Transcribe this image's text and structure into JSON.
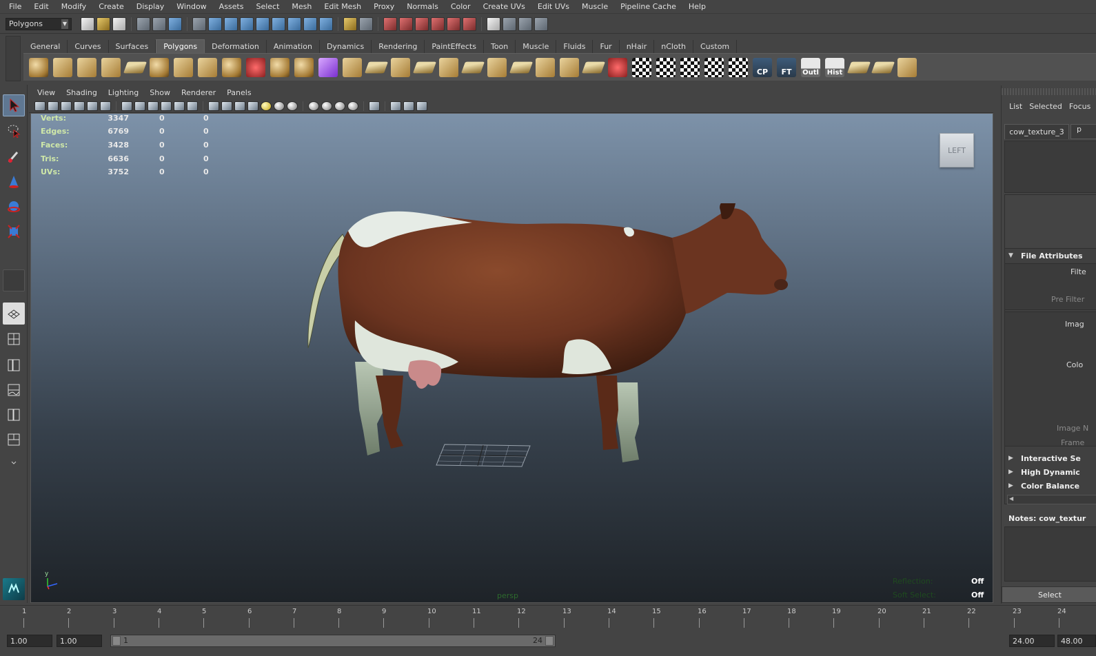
{
  "menubar": [
    "File",
    "Edit",
    "Modify",
    "Create",
    "Display",
    "Window",
    "Assets",
    "Select",
    "Mesh",
    "Edit Mesh",
    "Proxy",
    "Normals",
    "Color",
    "Create UVs",
    "Edit UVs",
    "Muscle",
    "Pipeline Cache",
    "Help"
  ],
  "status_line": {
    "mode": "Polygons"
  },
  "shelf_tabs": [
    "General",
    "Curves",
    "Surfaces",
    "Polygons",
    "Deformation",
    "Animation",
    "Dynamics",
    "Rendering",
    "PaintEffects",
    "Toon",
    "Muscle",
    "Fluids",
    "Fur",
    "nHair",
    "nCloth",
    "Custom"
  ],
  "shelf_active_tab": "Polygons",
  "shelf_text_icons": {
    "cp": "CP",
    "ft": "FT",
    "outl": "Outl",
    "hist": "Hist"
  },
  "viewport_menu": [
    "View",
    "Shading",
    "Lighting",
    "Show",
    "Renderer",
    "Panels"
  ],
  "hud": {
    "rows": [
      {
        "label": "Verts:",
        "v1": "3347",
        "v2": "0",
        "v3": "0"
      },
      {
        "label": "Edges:",
        "v1": "6769",
        "v2": "0",
        "v3": "0"
      },
      {
        "label": "Faces:",
        "v1": "3428",
        "v2": "0",
        "v3": "0"
      },
      {
        "label": "Tris:",
        "v1": "6636",
        "v2": "0",
        "v3": "0"
      },
      {
        "label": "UVs:",
        "v1": "3752",
        "v2": "0",
        "v3": "0"
      }
    ],
    "camera": "persp",
    "view_cube": "LEFT",
    "axis_y": "y",
    "reflection_label": "Reflection:",
    "reflection_value": "Off",
    "soft_select_label": "Soft Select:",
    "soft_select_value": "Off"
  },
  "attribute_editor": {
    "top_tabs": [
      "List",
      "Selected",
      "Focus"
    ],
    "node_tab": "cow_texture_3",
    "node_tab2": "p",
    "sections": [
      {
        "label": "File Attributes",
        "expanded": true
      },
      {
        "label": "Interactive Se",
        "expanded": false
      },
      {
        "label": "High Dynamic",
        "expanded": false
      },
      {
        "label": "Color Balance",
        "expanded": false
      }
    ],
    "fields": [
      "Filte",
      "Pre Filter",
      "Imag",
      "Colo",
      "Image N",
      "Frame"
    ],
    "notes": "Notes:  cow_textur",
    "select_button": "Select"
  },
  "timeline": {
    "frames": [
      "1",
      "2",
      "3",
      "4",
      "5",
      "6",
      "7",
      "8",
      "9",
      "10",
      "11",
      "12",
      "13",
      "14",
      "15",
      "16",
      "17",
      "18",
      "19",
      "20",
      "21",
      "22",
      "23",
      "24"
    ]
  },
  "range": {
    "start_time": "1.00",
    "playback_start": "1.00",
    "slider_start": "1",
    "slider_end": "24",
    "playback_end": "24.00",
    "end_time": "48.00"
  },
  "colors": {
    "viewport_top": "#7d92a9",
    "viewport_bottom": "#1e2328",
    "hud_label": "#cfe8a8",
    "cow_brown": "#6b3420"
  }
}
